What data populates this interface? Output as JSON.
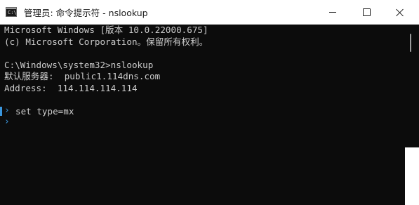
{
  "window": {
    "title": "管理员: 命令提示符 - nslookup",
    "icon": "cmd-icon",
    "controls": {
      "minimize": "minimize-icon",
      "maximize": "maximize-icon",
      "close": "close-icon"
    }
  },
  "console": {
    "lines": [
      "Microsoft Windows [版本 10.0.22000.675]",
      "(c) Microsoft Corporation。保留所有权利。",
      "",
      "C:\\Windows\\system32>nslookup",
      "默认服务器:  public1.114dns.com",
      "Address:  114.114.114.114",
      "",
      "set type=mx",
      ""
    ],
    "prompt_glyph": "›",
    "mark_color": "#3a96dd"
  }
}
